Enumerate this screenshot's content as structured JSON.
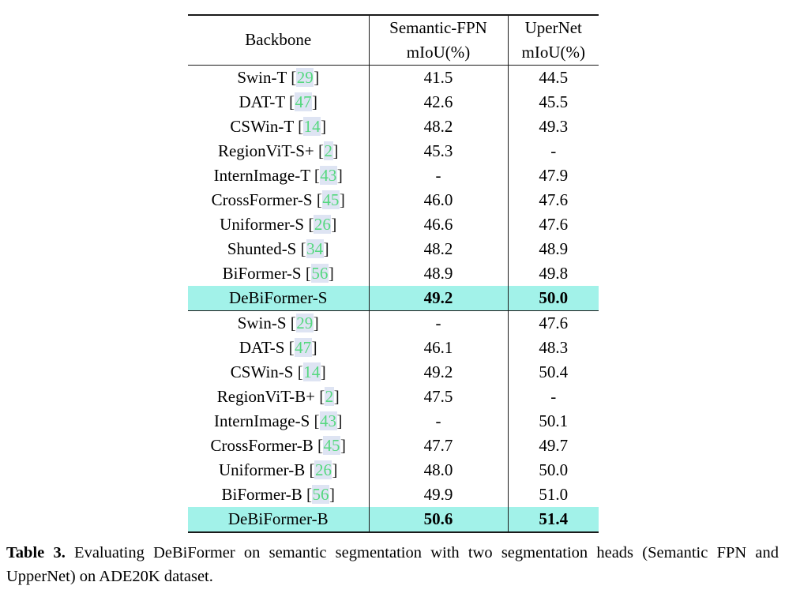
{
  "table": {
    "columns": [
      {
        "id": "backbone",
        "header_line1": "Backbone",
        "header_line2": ""
      },
      {
        "id": "semantic_fpn",
        "header_line1": "Semantic-FPN",
        "header_line2": "mIoU(%)"
      },
      {
        "id": "upernet",
        "header_line1": "UperNet",
        "header_line2": "mIoU(%)"
      }
    ],
    "blocks": [
      {
        "rows": [
          {
            "backbone": "Swin-T",
            "cite": "29",
            "semantic_fpn": "41.5",
            "upernet": "44.5",
            "highlight": false
          },
          {
            "backbone": "DAT-T",
            "cite": "47",
            "semantic_fpn": "42.6",
            "upernet": "45.5",
            "highlight": false
          },
          {
            "backbone": "CSWin-T",
            "cite": "14",
            "semantic_fpn": "48.2",
            "upernet": "49.3",
            "highlight": false
          },
          {
            "backbone": "RegionViT-S+",
            "cite": "2",
            "semantic_fpn": "45.3",
            "upernet": "-",
            "highlight": false
          },
          {
            "backbone": "InternImage-T",
            "cite": "43",
            "semantic_fpn": "-",
            "upernet": "47.9",
            "highlight": false
          },
          {
            "backbone": "CrossFormer-S",
            "cite": "45",
            "semantic_fpn": "46.0",
            "upernet": "47.6",
            "highlight": false
          },
          {
            "backbone": "Uniformer-S",
            "cite": "26",
            "semantic_fpn": "46.6",
            "upernet": "47.6",
            "highlight": false
          },
          {
            "backbone": "Shunted-S",
            "cite": "34",
            "semantic_fpn": "48.2",
            "upernet": "48.9",
            "highlight": false
          },
          {
            "backbone": "BiFormer-S",
            "cite": "56",
            "semantic_fpn": "48.9",
            "upernet": "49.8",
            "highlight": false
          },
          {
            "backbone": "DeBiFormer-S",
            "cite": "",
            "semantic_fpn": "49.2",
            "upernet": "50.0",
            "highlight": true
          }
        ]
      },
      {
        "rows": [
          {
            "backbone": "Swin-S",
            "cite": "29",
            "semantic_fpn": "-",
            "upernet": "47.6",
            "highlight": false
          },
          {
            "backbone": "DAT-S",
            "cite": "47",
            "semantic_fpn": "46.1",
            "upernet": "48.3",
            "highlight": false
          },
          {
            "backbone": "CSWin-S",
            "cite": "14",
            "semantic_fpn": "49.2",
            "upernet": "50.4",
            "highlight": false
          },
          {
            "backbone": "RegionViT-B+",
            "cite": "2",
            "semantic_fpn": "47.5",
            "upernet": "-",
            "highlight": false
          },
          {
            "backbone": "InternImage-S",
            "cite": "43",
            "semantic_fpn": "-",
            "upernet": "50.1",
            "highlight": false
          },
          {
            "backbone": "CrossFormer-B",
            "cite": "45",
            "semantic_fpn": "47.7",
            "upernet": "49.7",
            "highlight": false
          },
          {
            "backbone": "Uniformer-B",
            "cite": "26",
            "semantic_fpn": "48.0",
            "upernet": "50.0",
            "highlight": false
          },
          {
            "backbone": "BiFormer-B",
            "cite": "56",
            "semantic_fpn": "49.9",
            "upernet": "51.0",
            "highlight": false
          },
          {
            "backbone": "DeBiFormer-B",
            "cite": "",
            "semantic_fpn": "50.6",
            "upernet": "51.4",
            "highlight": true
          }
        ]
      }
    ]
  },
  "caption": {
    "label": "Table 3.",
    "text": " Evaluating DeBiFormer on semantic segmentation with two segmentation heads (Semantic FPN and UpperNet) on ADE20K dataset."
  },
  "colors": {
    "highlight_row": "#A2F2E9",
    "citation_text": "#55D87F",
    "citation_box": "#DEE4F3",
    "rule": "#1a1a1a"
  }
}
